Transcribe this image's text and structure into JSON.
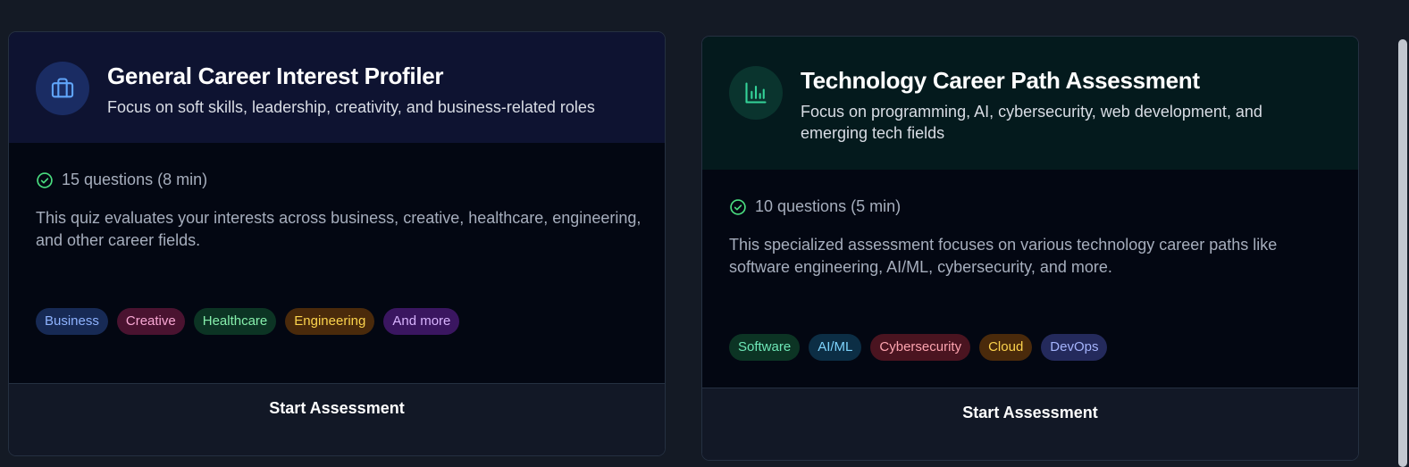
{
  "cards": [
    {
      "title": "General Career Interest Profiler",
      "subtitle": "Focus on soft skills, leadership, creativity, and business-related roles",
      "icon": "briefcase-icon",
      "accent": "#60a5fa",
      "meta": "15 questions (8 min)",
      "description": "This quiz evaluates your interests across business, creative, healthcare, engineering, and other career fields.",
      "tags": [
        {
          "label": "Business",
          "bg": "#172a55",
          "fg": "#8fb3ff"
        },
        {
          "label": "Creative",
          "bg": "#4a1330",
          "fg": "#f9a8d4"
        },
        {
          "label": "Healthcare",
          "bg": "#0c3424",
          "fg": "#86efac"
        },
        {
          "label": "Engineering",
          "bg": "#4a2a0b",
          "fg": "#fcd34d"
        },
        {
          "label": "And more",
          "bg": "#3a1660",
          "fg": "#d8b4fe"
        }
      ],
      "button": "Start Assessment"
    },
    {
      "title": "Technology Career Path Assessment",
      "subtitle": "Focus on programming, AI, cybersecurity, web development, and emerging tech fields",
      "icon": "bar-chart-icon",
      "accent": "#34d399",
      "meta": "10 questions (5 min)",
      "description": "This specialized assessment focuses on various technology career paths like software engineering, AI/ML, cybersecurity, and more.",
      "tags": [
        {
          "label": "Software",
          "bg": "#0c3424",
          "fg": "#6ee7b7"
        },
        {
          "label": "AI/ML",
          "bg": "#0c2e45",
          "fg": "#7dd3fc"
        },
        {
          "label": "Cybersecurity",
          "bg": "#4a1420",
          "fg": "#fda4af"
        },
        {
          "label": "Cloud",
          "bg": "#4a2a0b",
          "fg": "#fcd34d"
        },
        {
          "label": "DevOps",
          "bg": "#242a5c",
          "fg": "#a5b4fc"
        }
      ],
      "button": "Start Assessment"
    }
  ]
}
